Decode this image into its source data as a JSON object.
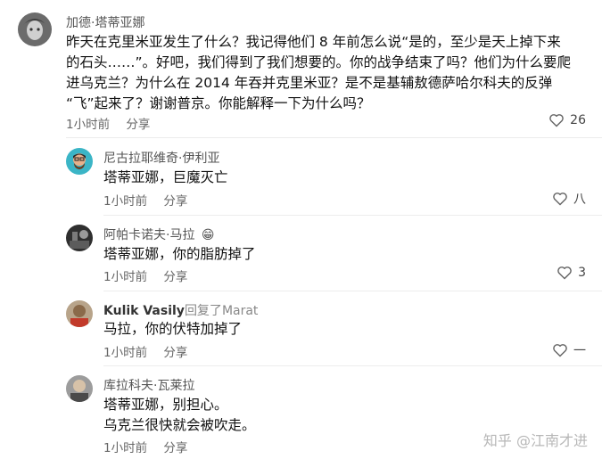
{
  "post": {
    "author": "加德·塔蒂亚娜",
    "lines": [
      "昨天在克里米亚发生了什么？我记得他们 8 年前怎么说“是的，至少是天上掉下来",
      "的石头……”。好吧，我们得到了我们想要的。你的战争结束了吗？他们为什么要爬",
      "进乌克兰？为什么在 2014 年吞并克里米亚？是不是基辅敖德萨哈尔科夫的反弹",
      "“飞”起来了？谢谢普京。你能解释一下为什么吗？"
    ],
    "time": "1小时前",
    "share": "分享",
    "likes": "26"
  },
  "replies": [
    {
      "author": "尼古拉耶维奇·伊利亚",
      "lines": [
        "塔蒂亚娜，巨魔灭亡"
      ],
      "time": "1小时前",
      "share": "分享",
      "likes": "八"
    },
    {
      "author": "阿帕卡诺夫·马拉",
      "emoji": "😁",
      "lines": [
        "塔蒂亚娜，你的脂肪掉了"
      ],
      "time": "1小时前",
      "share": "分享",
      "likes": "3"
    },
    {
      "author": "Kulik Vasily",
      "reply_word": "回复了",
      "reply_to": "Marat",
      "lines": [
        "马拉，你的伏特加掉了"
      ],
      "time": "1小时前",
      "share": "分享",
      "likes": "一"
    },
    {
      "author": "库拉科夫·瓦莱拉",
      "lines": [
        "塔蒂亚娜，别担心。",
        "乌克兰很快就会被吹走。"
      ],
      "time": "1小时前",
      "share": "分享"
    }
  ],
  "watermark": "知乎 @江南才进",
  "icons": {
    "like": "heart-outline-icon"
  },
  "colors": {
    "meta": "#666666",
    "text": "#111111",
    "divider": "#ececec"
  }
}
